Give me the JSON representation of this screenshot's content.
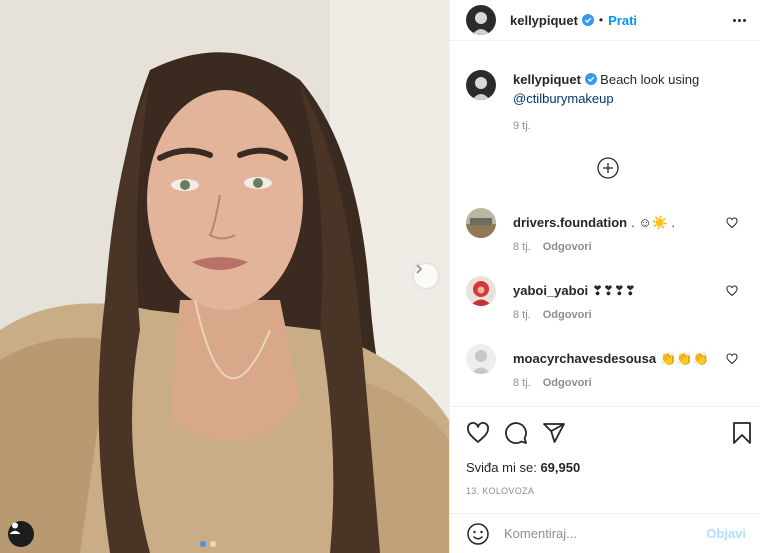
{
  "post": {
    "author": "kellypiquet",
    "verified": true,
    "follow_label": "Prati",
    "separator": "•",
    "caption_text": "Beach look using",
    "caption_mention": "@ctilburymakeup",
    "caption_age": "9 tj.",
    "likes_label": "Sviđa mi se:",
    "likes_count": "69,950",
    "date": "13. KOLOVOZA"
  },
  "comments": [
    {
      "username": "drivers.foundation",
      "text": ". ☺☀️ .",
      "age": "8 tj.",
      "reply_label": "Odgovori"
    },
    {
      "username": "yaboi_yaboi",
      "text": "❣❣❣❣",
      "age": "8 tj.",
      "reply_label": "Odgovori"
    },
    {
      "username": "moacyrchavesdesousa",
      "text": "👏👏👏",
      "age": "8 tj.",
      "reply_label": "Odgovori"
    }
  ],
  "comment_box": {
    "placeholder": "Komentiraj...",
    "post_label": "Objavi"
  },
  "icons": {
    "like": "heart-icon",
    "comment": "comment-icon",
    "share": "share-icon",
    "save": "bookmark-icon",
    "emoji": "emoji-icon",
    "more": "more-options-icon",
    "load_more": "plus-circle-icon",
    "next": "chevron-right-icon",
    "tag": "user-tag-icon"
  },
  "colors": {
    "accent": "#0095f6",
    "mention": "#00376b",
    "muted": "#8e8e8e",
    "post_disabled": "#b2dffc",
    "carousel_active": "#3a95ef"
  },
  "carousel": {
    "count": 2,
    "active": 1
  }
}
